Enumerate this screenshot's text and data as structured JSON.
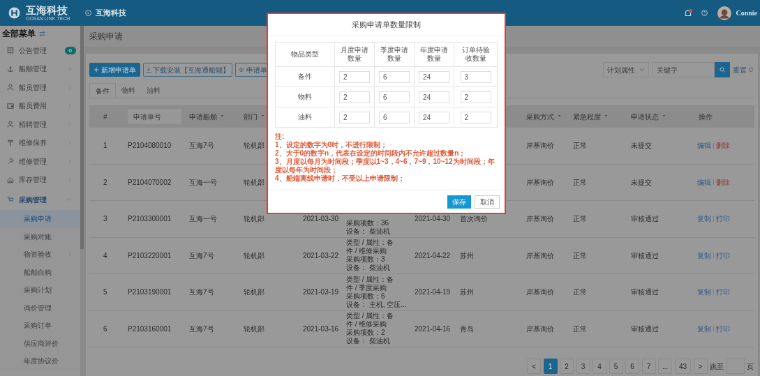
{
  "header": {
    "logo_title": "互海科技",
    "logo_subtitle": "OCEAN LINK TECH",
    "company": "互海科技",
    "user": "Connie"
  },
  "sidebar": {
    "title": "全部菜单",
    "items": [
      {
        "label": "公告管理",
        "badge": "0",
        "expanded": false,
        "has_arrow": false
      },
      {
        "label": "船舶管理",
        "expanded": false,
        "has_arrow": true
      },
      {
        "label": "船员管理",
        "expanded": false,
        "has_arrow": true
      },
      {
        "label": "船员费用",
        "expanded": false,
        "has_arrow": true
      },
      {
        "label": "招聘管理",
        "expanded": false,
        "has_arrow": true
      },
      {
        "label": "维修保养",
        "expanded": false,
        "has_arrow": true
      },
      {
        "label": "维修管理",
        "expanded": false,
        "has_arrow": true
      },
      {
        "label": "库存管理",
        "expanded": false,
        "has_arrow": true
      },
      {
        "label": "采购管理",
        "expanded": true,
        "has_arrow": true,
        "children": [
          {
            "label": "采购申请",
            "selected": true,
            "has_arrow": false
          },
          {
            "label": "采购对账",
            "selected": false,
            "has_arrow": false
          },
          {
            "label": "物资验收",
            "selected": false,
            "has_arrow": true
          },
          {
            "label": "船舶自购",
            "selected": false,
            "has_arrow": false
          },
          {
            "label": "采购计划",
            "selected": false,
            "has_arrow": false
          },
          {
            "label": "询价管理",
            "selected": false,
            "has_arrow": false
          },
          {
            "label": "采购订单",
            "selected": false,
            "has_arrow": false
          },
          {
            "label": "供应商评价",
            "selected": false,
            "has_arrow": false
          },
          {
            "label": "年度协议价",
            "selected": false,
            "has_arrow": false
          }
        ]
      }
    ]
  },
  "page_title": "采购申请",
  "toolbar": {
    "buttons": [
      {
        "label": "新增申请单",
        "kind": "primary"
      },
      {
        "label": "下载安装【互海通船端】",
        "kind": "download"
      },
      {
        "label": "申请单",
        "kind": "settings"
      }
    ],
    "filter": {
      "value": "计划属性"
    },
    "search": {
      "placeholder": "关键字"
    },
    "reset": "重置"
  },
  "tabs": [
    {
      "label": "备件",
      "selected": true
    },
    {
      "label": "物料",
      "selected": false
    },
    {
      "label": "油料",
      "selected": false
    }
  ],
  "table": {
    "columns": [
      {
        "label": "#",
        "kind": "text"
      },
      {
        "placeholder": "申请单号",
        "kind": "search"
      },
      {
        "label": "申请船舶",
        "kind": "sort"
      },
      {
        "label": "部门",
        "kind": "sort"
      },
      {
        "kind": "hidden"
      },
      {
        "kind": "hidden"
      },
      {
        "kind": "hidden"
      },
      {
        "kind": "hidden"
      },
      {
        "label": "采购方式",
        "kind": "sort"
      },
      {
        "label": "紧急程度",
        "kind": "sort"
      },
      {
        "label": "申请状态",
        "kind": "sort"
      },
      {
        "label": "操作",
        "kind": "text"
      }
    ],
    "rows": [
      {
        "index": "1",
        "number": "P2104080010",
        "ship": "互海7号",
        "dept": "轮机部",
        "method": "岸基询价",
        "urgency": "正常",
        "status": "未提交",
        "actions": [
          {
            "label": "编辑",
            "kind": "edit"
          },
          {
            "label": "删除",
            "kind": "delete"
          }
        ]
      },
      {
        "index": "2",
        "number": "P2104070002",
        "ship": "互海一号",
        "dept": "轮机部",
        "method": "岸基询价",
        "urgency": "正常",
        "status": "未提交",
        "actions": [
          {
            "label": "编辑",
            "kind": "edit"
          },
          {
            "label": "删除",
            "kind": "delete"
          }
        ]
      },
      {
        "index": "3",
        "number": "P2103300001",
        "ship": "互海一号",
        "dept": "轮机部",
        "apply_date": "2021-03-30",
        "details": [
          "采购项数：36",
          "设备： 柴油机"
        ],
        "need_date": "2021-04-30",
        "place": "首次询价",
        "method": "岸基询价",
        "urgency": "正常",
        "status": "审核通过",
        "actions": [
          {
            "label": "复制",
            "kind": "copy"
          },
          {
            "label": "打印",
            "kind": "print"
          }
        ]
      },
      {
        "index": "4",
        "number": "P2103220001",
        "ship": "互海7号",
        "dept": "轮机部",
        "apply_date": "2021-03-22",
        "details": [
          "类型 / 属性：备",
          "件 / 维修采购",
          "采购项数：3",
          "设备： 柴油机"
        ],
        "need_date": "2021-04-22",
        "place": "苏州",
        "method": "岸基询价",
        "urgency": "正常",
        "status": "审核通过",
        "actions": [
          {
            "label": "复制",
            "kind": "copy"
          },
          {
            "label": "打印",
            "kind": "print"
          }
        ]
      },
      {
        "index": "5",
        "number": "P2103190001",
        "ship": "互海7号",
        "dept": "轮机部",
        "apply_date": "2021-03-19",
        "details": [
          "类型 / 属性：备",
          "件 / 季度采购",
          "采购项数：6",
          "设备： 主机, 空压..."
        ],
        "need_date": "2021-04-19",
        "place": "苏州",
        "method": "岸基询价",
        "urgency": "正常",
        "status": "审核通过",
        "actions": [
          {
            "label": "复制",
            "kind": "copy"
          },
          {
            "label": "打印",
            "kind": "print"
          }
        ]
      },
      {
        "index": "6",
        "number": "P2103160001",
        "ship": "互海7号",
        "dept": "轮机部",
        "apply_date": "2021-03-16",
        "details": [
          "类型 / 属性：备",
          "件 / 维修采购",
          "采购项数：2",
          "设备： 柴油机"
        ],
        "need_date": "2021-04-16",
        "place": "青岛",
        "method": "岸基询价",
        "urgency": "正常",
        "status": "审核通过",
        "actions": [
          {
            "label": "复制",
            "kind": "copy"
          },
          {
            "label": "打印",
            "kind": "print"
          }
        ]
      }
    ]
  },
  "pagination": {
    "prev": "<",
    "next": ">",
    "pages": [
      {
        "label": "1",
        "selected": true
      },
      {
        "label": "2",
        "selected": false
      },
      {
        "label": "3",
        "selected": false
      },
      {
        "label": "4",
        "selected": false
      },
      {
        "label": "5",
        "selected": false
      },
      {
        "label": "6",
        "selected": false
      },
      {
        "label": "7",
        "selected": false
      },
      {
        "label": "...",
        "selected": false
      },
      {
        "label": "43",
        "selected": false
      }
    ],
    "jump_label": "跳至",
    "page_unit": "页"
  },
  "modal": {
    "title": "采购申请单数量限制",
    "columns": [
      "物品类型",
      "月度申请数量",
      "季度申请数量",
      "年度申请数量",
      "订单待验收数量"
    ],
    "rows": [
      {
        "type": "备件",
        "values": [
          "2",
          "6",
          "24",
          "3"
        ]
      },
      {
        "type": "物料",
        "values": [
          "2",
          "6",
          "24",
          "2"
        ]
      },
      {
        "type": "油料",
        "values": [
          "2",
          "6",
          "24",
          "2"
        ]
      }
    ],
    "notes": [
      "注:",
      "1、设定的数字为0时，不进行限制；",
      "2、大于0的数字n，代表在设定的时间段内不允许超过数量n；",
      "3、月度以每月为时间段；季度以1~3，4~6，7~9，10~12为时间段；年度以每年为时间段；",
      "4、船端离线申请时，不受以上申请限制；"
    ],
    "buttons": [
      {
        "label": "保存",
        "kind": "primary"
      },
      {
        "label": "取消",
        "kind": "default"
      }
    ]
  }
}
